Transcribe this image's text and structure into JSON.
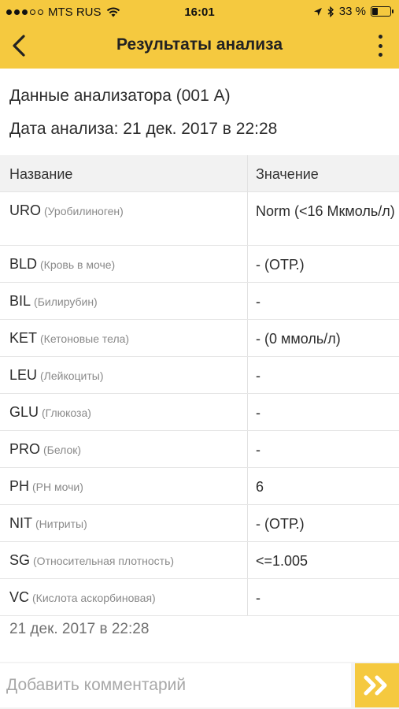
{
  "status_bar": {
    "carrier": "MTS RUS",
    "time": "16:01",
    "battery": "33 %",
    "battery_level": 0.33
  },
  "nav": {
    "title": "Результаты анализа"
  },
  "info": {
    "analyzer": "Данные анализатора (001 А)",
    "date": "Дата анализа: 21 дек. 2017 в 22:28"
  },
  "table": {
    "headers": [
      "Название",
      "Значение"
    ],
    "rows": [
      {
        "code": "URO",
        "desc": "(Уробилиноген)",
        "value": "Norm (<16 Мкмоль/л)"
      },
      {
        "code": "BLD",
        "desc": "(Кровь в моче)",
        "value": "- (ОТР.)"
      },
      {
        "code": "BIL",
        "desc": "(Билирубин)",
        "value": "-"
      },
      {
        "code": "KET",
        "desc": "(Кетоновые тела)",
        "value": "- (0 ммоль/л)"
      },
      {
        "code": "LEU",
        "desc": "(Лейкоциты)",
        "value": "-"
      },
      {
        "code": "GLU",
        "desc": "(Глюкоза)",
        "value": "-"
      },
      {
        "code": "PRO",
        "desc": "(Белок)",
        "value": "-"
      },
      {
        "code": "PH",
        "desc": "(PH мочи)",
        "value": "6"
      },
      {
        "code": "NIT",
        "desc": "(Нитриты)",
        "value": "- (ОТР.)"
      },
      {
        "code": "SG",
        "desc": "(Относительная плотность)",
        "value": "<=1.005"
      },
      {
        "code": "VC",
        "desc": "(Кислота аскорбиновая)",
        "value": "-"
      }
    ]
  },
  "timestamp": "21 дек. 2017 в 22:28",
  "comment": {
    "placeholder": "Добавить комментарий",
    "value": ""
  },
  "colors": {
    "accent": "#f5c93f"
  }
}
